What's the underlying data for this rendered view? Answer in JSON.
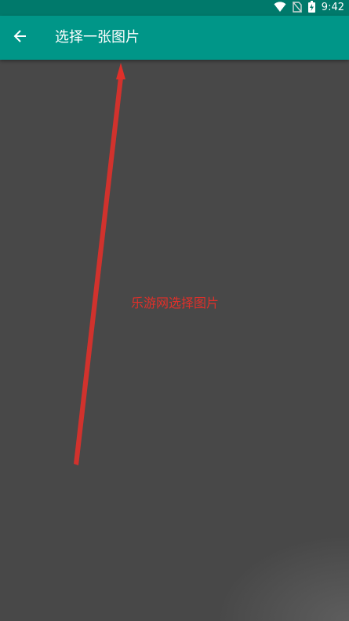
{
  "status_bar": {
    "time": "9:42",
    "icons": [
      "wifi-icon",
      "no-sim-icon",
      "battery-charging-icon"
    ]
  },
  "app_bar": {
    "back_icon": "arrow-left-icon",
    "title": "选择一张图片"
  },
  "annotation": {
    "text": "乐游网选择图片"
  },
  "colors": {
    "status_bar": "#00796B",
    "app_bar": "#009688",
    "content_bg": "#484848",
    "annotation": "#e0302a"
  }
}
